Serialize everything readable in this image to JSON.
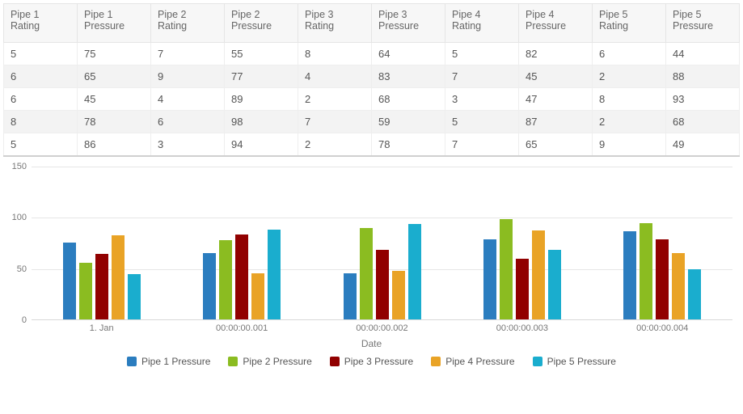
{
  "table": {
    "columns": [
      "Pipe 1 Rating",
      "Pipe 1 Pressure",
      "Pipe 2 Rating",
      "Pipe 2 Pressure",
      "Pipe 3 Rating",
      "Pipe 3 Pressure",
      "Pipe 4 Rating",
      "Pipe 4 Pressure",
      "Pipe 5 Rating",
      "Pipe 5 Pressure"
    ],
    "rows": [
      [
        "5",
        "75",
        "7",
        "55",
        "8",
        "64",
        "5",
        "82",
        "6",
        "44"
      ],
      [
        "6",
        "65",
        "9",
        "77",
        "4",
        "83",
        "7",
        "45",
        "2",
        "88"
      ],
      [
        "6",
        "45",
        "4",
        "89",
        "2",
        "68",
        "3",
        "47",
        "8",
        "93"
      ],
      [
        "8",
        "78",
        "6",
        "98",
        "7",
        "59",
        "5",
        "87",
        "2",
        "68"
      ],
      [
        "5",
        "86",
        "3",
        "94",
        "2",
        "78",
        "7",
        "65",
        "9",
        "49"
      ]
    ]
  },
  "chart_data": {
    "type": "bar",
    "xlabel": "Date",
    "ylabel": "",
    "ylim": [
      0,
      150
    ],
    "yticks": [
      0,
      50,
      100,
      150
    ],
    "categories": [
      "1. Jan",
      "00:00:00.001",
      "00:00:00.002",
      "00:00:00.003",
      "00:00:00.004"
    ],
    "series": [
      {
        "name": "Pipe 1 Pressure",
        "color": "#2b7dbf",
        "values": [
          75,
          65,
          45,
          78,
          86
        ]
      },
      {
        "name": "Pipe 2 Pressure",
        "color": "#8bbc21",
        "values": [
          55,
          77,
          89,
          98,
          94
        ]
      },
      {
        "name": "Pipe 3 Pressure",
        "color": "#910000",
        "values": [
          64,
          83,
          68,
          59,
          78
        ]
      },
      {
        "name": "Pipe 4 Pressure",
        "color": "#e9a326",
        "values": [
          82,
          45,
          47,
          87,
          65
        ]
      },
      {
        "name": "Pipe 5 Pressure",
        "color": "#1aadce",
        "values": [
          44,
          88,
          93,
          68,
          49
        ]
      }
    ],
    "legend_position": "bottom"
  }
}
